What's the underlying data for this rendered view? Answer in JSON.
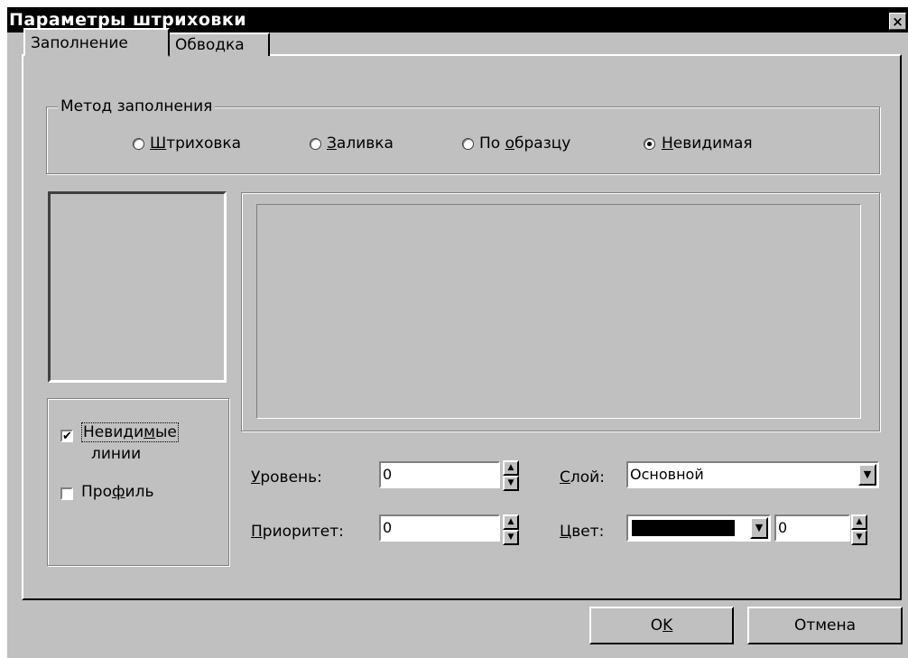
{
  "window": {
    "title": "Параметры штриховки",
    "close_glyph": "×"
  },
  "tabs": [
    {
      "label": "Заполнение",
      "active": true
    },
    {
      "label": "Обводка",
      "active": false
    }
  ],
  "fill_method": {
    "legend": "Метод заполнения",
    "options": [
      {
        "label": "Штриховка",
        "accel": "Ш",
        "rest": "триховка",
        "selected": false
      },
      {
        "label": "Заливка",
        "accel": "З",
        "rest": "аливка",
        "selected": false
      },
      {
        "label": "По образцу",
        "pre": "По ",
        "accel": "о",
        "rest": "бразцу",
        "selected": false
      },
      {
        "label": "Невидимая",
        "accel": "Н",
        "rest": "евидимая",
        "selected": true
      }
    ]
  },
  "checkboxes": {
    "invisible_lines": {
      "line1_pre": "Невиди",
      "line1_accel": "м",
      "line1_post": "ые",
      "line2": "линии",
      "checked": true,
      "mark": "✔"
    },
    "profile": {
      "pre": "Про",
      "accel": "ф",
      "post": "иль",
      "checked": false
    }
  },
  "fields": {
    "level": {
      "accel": "У",
      "rest": "ровень:",
      "value": "0"
    },
    "priority": {
      "accel": "П",
      "rest": "риоритет:",
      "value": "0"
    },
    "layer": {
      "accel": "С",
      "rest": "лой:",
      "value": "Основной"
    },
    "color": {
      "accel": "Ц",
      "rest": "вет:",
      "swatch": "#000000",
      "value": "0"
    }
  },
  "buttons": {
    "ok": {
      "pre": "О",
      "accel": "K"
    },
    "cancel": "Отмена"
  },
  "icons": {
    "spin_up": "▲",
    "spin_down": "▼",
    "dropdown": "▼"
  }
}
